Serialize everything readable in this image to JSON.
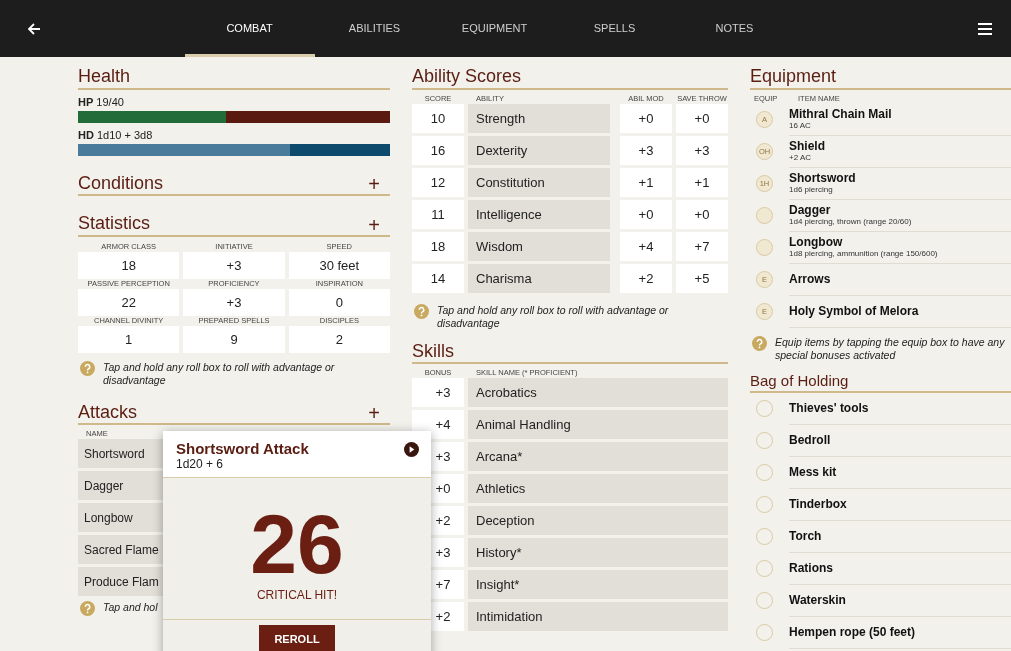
{
  "tabs": [
    {
      "label": "COMBAT",
      "selected": true
    },
    {
      "label": "ABILITIES",
      "selected": false
    },
    {
      "label": "EQUIPMENT",
      "selected": false
    },
    {
      "label": "SPELLS",
      "selected": false
    },
    {
      "label": "NOTES",
      "selected": false
    }
  ],
  "health": {
    "title": "Health",
    "bars": [
      {
        "kind": "hp",
        "label": "HP",
        "value": "19/40",
        "level": 0.475
      },
      {
        "kind": "hd",
        "label": "HD",
        "value": "1d10 + 3d8",
        "level": 0.68
      }
    ]
  },
  "conditions": {
    "title": "Conditions",
    "add": "+"
  },
  "statistics": {
    "title": "Statistics",
    "add": "+",
    "items": [
      {
        "label": "ARMOR CLASS",
        "value": "18"
      },
      {
        "label": "INITIATIVE",
        "value": "+3"
      },
      {
        "label": "SPEED",
        "value": "30 feet"
      },
      {
        "label": "PASSIVE PERCEPTION",
        "value": "22"
      },
      {
        "label": "PROFICIENCY",
        "value": "+3"
      },
      {
        "label": "INSPIRATION",
        "value": "0"
      },
      {
        "label": "CHANNEL DIVINITY",
        "value": "1"
      },
      {
        "label": "PREPARED SPELLS",
        "value": "9"
      },
      {
        "label": "DISCIPLES",
        "value": "2"
      }
    ],
    "hint": "Tap and hold any roll box to roll with advantage or disadvantage"
  },
  "attacks": {
    "title": "Attacks",
    "add": "+",
    "column": "NAME",
    "rows": [
      "Shortsword",
      "Dagger",
      "Longbow",
      "Sacred Flame",
      "Produce Flam"
    ],
    "hint": "Tap and hol"
  },
  "ability_scores": {
    "title": "Ability Scores",
    "columns": [
      "SCORE",
      "ABILITY",
      "ABIL MOD",
      "SAVE THROW"
    ],
    "rows": [
      {
        "score": "10",
        "ability": "Strength",
        "mod": "+0",
        "save": "+0"
      },
      {
        "score": "16",
        "ability": "Dexterity",
        "mod": "+3",
        "save": "+3"
      },
      {
        "score": "12",
        "ability": "Constitution",
        "mod": "+1",
        "save": "+1"
      },
      {
        "score": "11",
        "ability": "Intelligence",
        "mod": "+0",
        "save": "+0"
      },
      {
        "score": "18",
        "ability": "Wisdom",
        "mod": "+4",
        "save": "+7"
      },
      {
        "score": "14",
        "ability": "Charisma",
        "mod": "+2",
        "save": "+5"
      }
    ],
    "hint": "Tap and hold any roll box to roll with advantage or disadvantage"
  },
  "skills": {
    "title": "Skills",
    "columns": [
      "BONUS",
      "SKILL NAME (* PROFICIENT)"
    ],
    "rows": [
      {
        "bonus": "+3",
        "name": "Acrobatics"
      },
      {
        "bonus": "+4",
        "name": "Animal Handling"
      },
      {
        "bonus": "+3",
        "name": "Arcana*"
      },
      {
        "bonus": "+0",
        "name": "Athletics"
      },
      {
        "bonus": "+2",
        "name": "Deception"
      },
      {
        "bonus": "+3",
        "name": "History*"
      },
      {
        "bonus": "+7",
        "name": "Insight*"
      },
      {
        "bonus": "+2",
        "name": "Intimidation"
      }
    ]
  },
  "equipment": {
    "title": "Equipment",
    "columns": [
      "EQUIP",
      "ITEM NAME"
    ],
    "items": [
      {
        "slot": "A",
        "name": "Mithral Chain Mail",
        "detail": "16 AC"
      },
      {
        "slot": "OH",
        "name": "Shield",
        "detail": "+2 AC"
      },
      {
        "slot": "1H",
        "name": "Shortsword",
        "detail": "1d6 piercing"
      },
      {
        "name": "Dagger",
        "detail": "1d4 piercing, thrown (range 20/60)"
      },
      {
        "name": "Longbow",
        "detail": "1d8 piercing, ammunition (range 150/600)"
      },
      {
        "slot": "E",
        "name": "Arrows"
      },
      {
        "slot": "E",
        "name": "Holy Symbol of Melora"
      }
    ],
    "hint": "Equip items by tapping the equip box to have any special bonuses activated"
  },
  "bag_of_holding": {
    "title": "Bag of Holding",
    "items": [
      "Thieves' tools",
      "Bedroll",
      "Mess kit",
      "Tinderbox",
      "Torch",
      "Rations",
      "Waterskin",
      "Hempen rope (50 feet)"
    ]
  },
  "roll_popup": {
    "title": "Shortsword Attack",
    "formula": "1d20 + 6",
    "result": "26",
    "outcome": "CRITICAL HIT!",
    "button": "REROLL"
  }
}
